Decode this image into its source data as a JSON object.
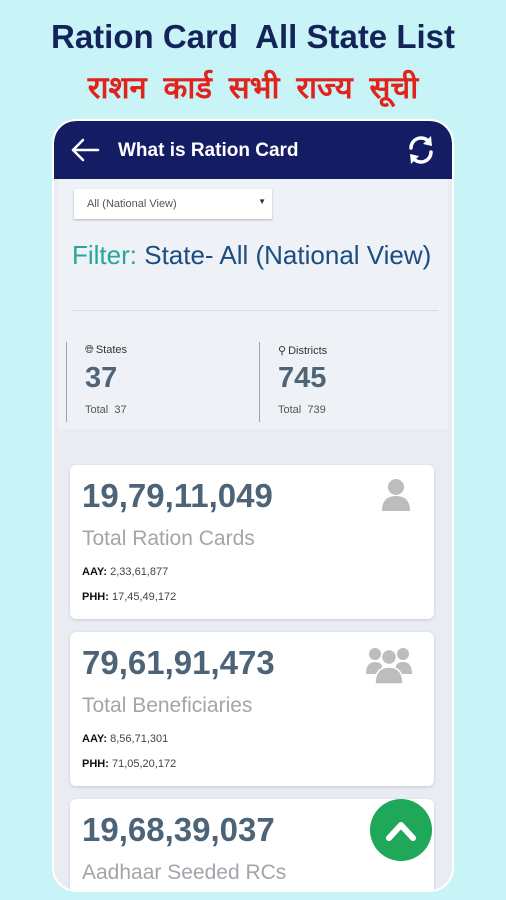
{
  "promo": {
    "title": "Ration Card  All State List",
    "subtitle_hindi": "राशन कार्ड सभी राज्य सूची"
  },
  "appbar": {
    "title": "What is Ration Card",
    "back_icon": "arrow-left-icon",
    "refresh_icon": "refresh-icon"
  },
  "filter": {
    "select_value": "All (National View)",
    "label": "Filter:",
    "value": " State- All (National View)"
  },
  "stats": {
    "states": {
      "heading": "States",
      "value": "37",
      "total_label": "Total",
      "total": "37",
      "icon": "globe-icon"
    },
    "districts": {
      "heading": "Districts",
      "value": "745",
      "total_label": "Total",
      "total": "739",
      "icon": "map-pin-icon"
    }
  },
  "cards": [
    {
      "value": "19,79,11,049",
      "label": "Total Ration Cards",
      "aay_label": "AAY:",
      "aay": "2,33,61,877",
      "phh_label": "PHH:",
      "phh": "17,45,49,172",
      "icon": "user-icon"
    },
    {
      "value": "79,61,91,473",
      "label": "Total Beneficiaries",
      "aay_label": "AAY:",
      "aay": "8,56,71,301",
      "phh_label": "PHH:",
      "phh": "71,05,20,172",
      "icon": "users-group-icon"
    },
    {
      "value": "19,68,39,037",
      "label": "Aadhaar Seeded RCs"
    }
  ],
  "colors": {
    "background": "#c9f4f7",
    "appbar": "#141d63",
    "promo_title": "#14245a",
    "promo_subtitle": "#e0241c",
    "filter_label": "#25a89a",
    "filter_value": "#1b4d80",
    "scroll_button": "#1fa85a"
  }
}
